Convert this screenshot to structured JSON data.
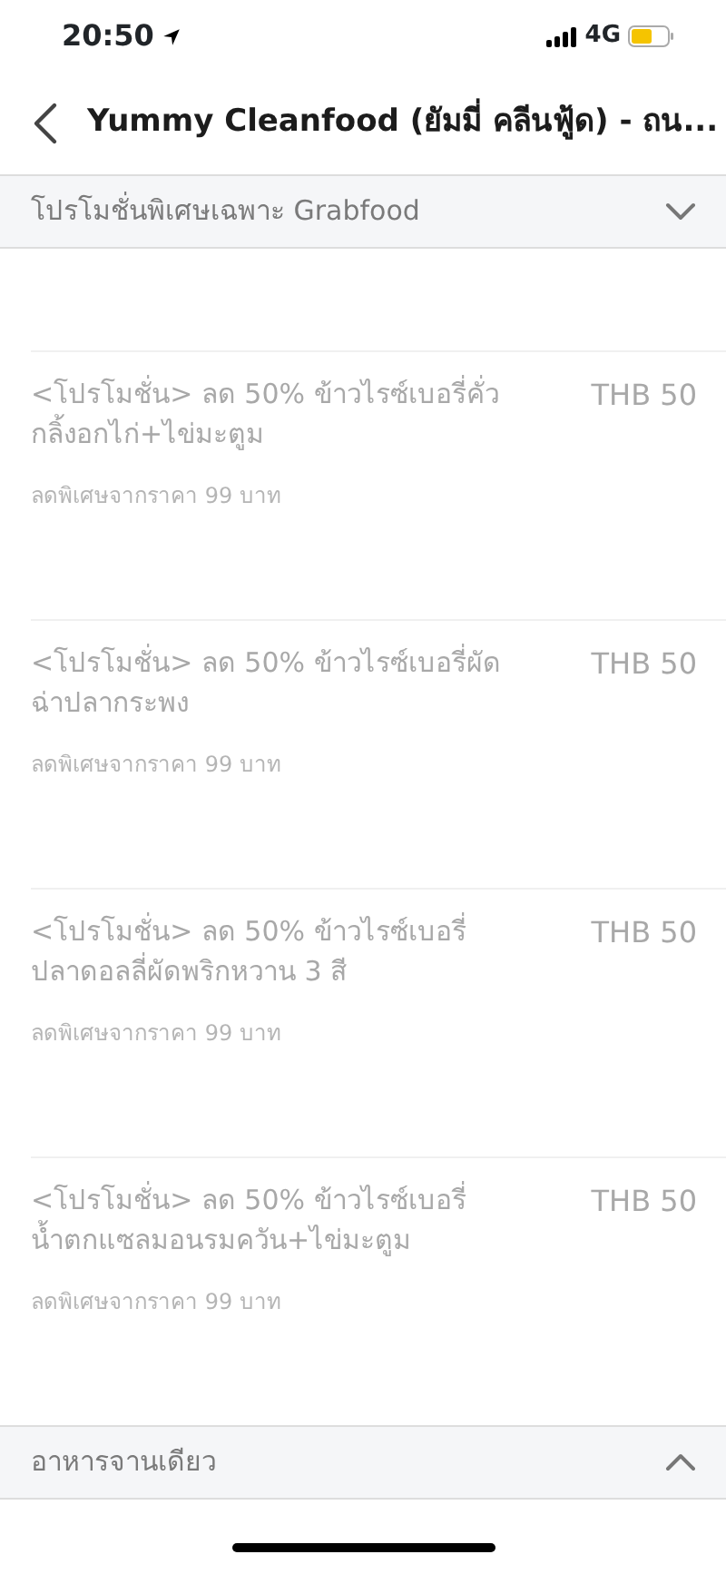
{
  "status_bar": {
    "time": "20:50",
    "network": "4G"
  },
  "header": {
    "title": "Yummy Cleanfood (ยัมมี่ คลีนฟู้ด) - ถน..."
  },
  "sections": [
    {
      "title": "โปรโมชั่นพิเศษเฉพาะ Grabfood",
      "expanded": true,
      "items": [
        {
          "name": "<โปรโมชั่น> ลด 50% ข้าวไรซ์เบอรี่คั่วกลิ้งอกไก่+ไข่มะตูม",
          "price": "THB 50",
          "note": "ลดพิเศษจากราคา 99 บาท",
          "disabled": true
        },
        {
          "name": "<โปรโมชั่น> ลด 50% ข้าวไรซ์เบอรี่ผัดฉ่าปลากระพง",
          "price": "THB 50",
          "note": "ลดพิเศษจากราคา 99 บาท",
          "disabled": true
        },
        {
          "name": "<โปรโมชั่น> ลด 50% ข้าวไรซ์เบอรี่ปลาดอลลี่ผัดพริกหวาน 3 สี",
          "price": "THB 50",
          "note": "ลดพิเศษจากราคา 99 บาท",
          "disabled": true
        },
        {
          "name": "<โปรโมชั่น> ลด 50% ข้าวไรซ์เบอรี่น้ำตกแซลมอนรมควัน+ไข่มะตูม",
          "price": "THB 50",
          "note": "ลดพิเศษจากราคา 99 บาท",
          "disabled": true
        }
      ]
    },
    {
      "title": "อาหารจานเดียว",
      "expanded": false
    }
  ]
}
